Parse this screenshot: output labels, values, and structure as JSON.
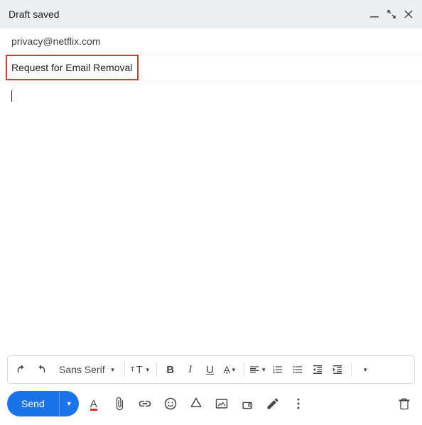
{
  "header": {
    "title": "Draft saved"
  },
  "to": "privacy@netflix.com",
  "subject": "Request for Email Removal",
  "toolbar": {
    "font": "Sans Serif"
  },
  "actions": {
    "send": "Send"
  },
  "format": {
    "bold": "B",
    "italic": "I",
    "underline": "U",
    "colorA": "A"
  }
}
